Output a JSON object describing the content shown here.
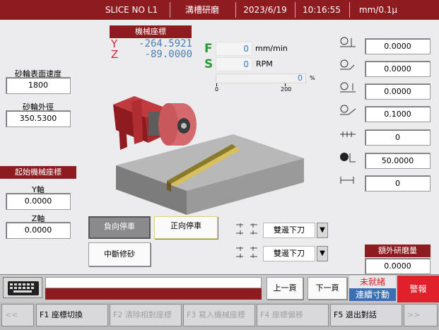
{
  "header": {
    "program": "SLICE NO L1",
    "mode": "溝槽研磨",
    "date": "2023/6/19",
    "time": "10:16:55",
    "units": "mm/0.1μ"
  },
  "machine_coords": {
    "title": "機械座標",
    "y_label": "Y",
    "y_value": "-264.5921",
    "z_label": "Z",
    "z_value": "-89.0000"
  },
  "feed_speed": {
    "f_label": "F",
    "f_value": "0",
    "f_unit": "mm/min",
    "s_label": "S",
    "s_value": "0",
    "s_unit": "RPM",
    "override_value": "0",
    "override_unit": "%",
    "scale_min": "0",
    "scale_max": "200",
    "override_fraction": 0
  },
  "left_panel": {
    "surface_speed_label": "砂輪表面速度",
    "surface_speed_value": "1800",
    "outer_diameter_label": "砂輪外徑",
    "outer_diameter_value": "350.5300",
    "start_coords_title": "起始機械座標",
    "y_axis_label": "Y軸",
    "y_axis_value": "0.0000",
    "z_axis_label": "Z軸",
    "z_axis_value": "0.0000"
  },
  "right_params": [
    {
      "icon": "depth-icon",
      "value": "0.0000"
    },
    {
      "icon": "grind-depth-icon",
      "value": "0.0000"
    },
    {
      "icon": "step-down-icon",
      "value": "0.0000"
    },
    {
      "icon": "finish-depth-icon",
      "value": "0.1000"
    },
    {
      "icon": "spark-out-icon",
      "value": "0"
    },
    {
      "icon": "feed-rate-icon",
      "value": "50.0000"
    },
    {
      "icon": "count-icon",
      "value": "0"
    }
  ],
  "buttons": {
    "neg_stop": "負向停車",
    "pos_stop": "正向停車",
    "interrupt_dress": "中斷修砂"
  },
  "dropdowns": [
    {
      "icon": "feed-mode-icon-1",
      "value": "雙邊下刀"
    },
    {
      "icon": "feed-mode-icon-2",
      "value": "雙邊下刀"
    }
  ],
  "extra_grind": {
    "title": "額外研磨量",
    "value": "0.0000"
  },
  "action_bar": {
    "keyboard_icon": "keyboard-icon",
    "message": "",
    "prev_page": "上一頁",
    "next_page": "下一頁",
    "status_not_ready": "未就緒",
    "status_jog": "連續寸動",
    "alarm": "警報"
  },
  "function_keys": {
    "prev": "<<",
    "next": ">>",
    "keys": [
      {
        "label": "F1 座標切換",
        "enabled": true
      },
      {
        "label": "F2 清除相對座標",
        "enabled": false
      },
      {
        "label": "F3 寫入機械座標",
        "enabled": false
      },
      {
        "label": "F4 座標偏移",
        "enabled": false
      },
      {
        "label": "F5 退出對話",
        "enabled": true
      }
    ]
  },
  "colors": {
    "header_bg": "#8e1b1f",
    "coord_value": "#4a7fb5",
    "axis_label": "#d0262a",
    "fs_label": "#2b9a3a",
    "status_blue": "#3a6fb3",
    "alarm_red": "#e0202a"
  }
}
